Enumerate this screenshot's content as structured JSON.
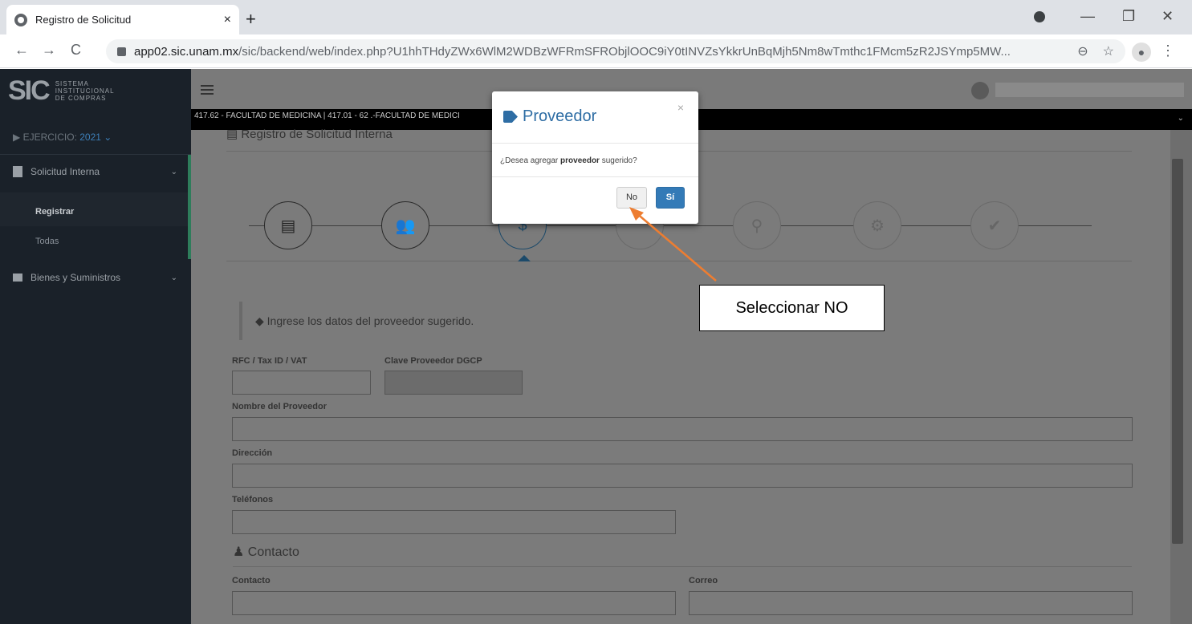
{
  "browser": {
    "tab_title": "Registro de Solicitud",
    "tab_close": "×",
    "new_tab": "+",
    "url_host": "app02.sic.unam.mx",
    "url_path": "/sic/backend/web/index.php?U1hhTHdyZWx6WlM2WDBzWFRmSFRObjlOOC9iY0tINVZsYkkrUnBqMjh5Nm8wTmthc1FMcm5zR2JSYmp5MW...",
    "min": "—",
    "max": "❐",
    "close": "✕",
    "back": "←",
    "forward": "→",
    "reload": "C",
    "zoom_icon": "⊖",
    "star_icon": "☆",
    "menu": "⋮"
  },
  "sidebar": {
    "logo_big": "SIC",
    "logo_small": [
      "SISTEMA",
      "INSTITUCIONAL",
      "DE COMPRAS"
    ],
    "ejercicio_label": "▶ EJERCICIO:",
    "ejercicio_year": "2021 ⌄",
    "items": [
      {
        "label": "Solicitud Interna",
        "chevron": "⌄"
      },
      {
        "label": "Bienes y Suministros",
        "chevron": "⌄"
      }
    ],
    "sub_items": [
      {
        "label": "Registrar"
      },
      {
        "label": "Todas"
      }
    ]
  },
  "header": {
    "dependency_text": "417.62 - FACULTAD DE MEDICINA | 417.01 - 62 .-FACULTAD DE MEDICI",
    "page_title": "Registro de Solicitud Interna"
  },
  "steps": {
    "icons": [
      "▤",
      "👥",
      "$",
      "",
      "⚲",
      "⚙",
      "✔"
    ]
  },
  "form": {
    "note": "Ingrese los datos del proveedor sugerido.",
    "rfc_label": "RFC / Tax ID / VAT",
    "clave_label": "Clave Proveedor DGCP",
    "nombre_label": "Nombre del Proveedor",
    "direccion_label": "Dirección",
    "telefonos_label": "Teléfonos",
    "contacto_section": "Contacto",
    "contacto_label": "Contacto",
    "correo_label": "Correo"
  },
  "modal": {
    "title": "Proveedor",
    "close": "×",
    "body_pre": "¿Desea agregar ",
    "body_bold": "proveedor",
    "body_post": " sugerido?",
    "no_label": "No",
    "si_label": "Sí"
  },
  "annotation": {
    "callout_text": "Seleccionar NO",
    "arrow_color": "#ed7d31"
  }
}
